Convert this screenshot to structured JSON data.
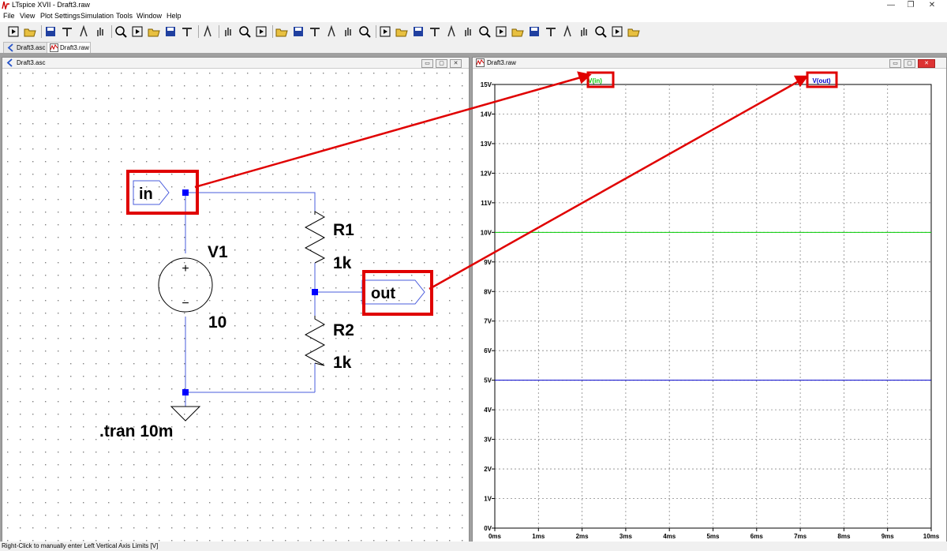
{
  "window": {
    "title": "LTspice XVII - Draft3.raw"
  },
  "menu": [
    "File",
    "View",
    "Plot Settings",
    "Simulation",
    "Tools",
    "Window",
    "Help"
  ],
  "toolbar": {
    "icons": [
      "run-icon",
      "open-icon",
      "save-icon",
      "control-panel-icon",
      "halt-icon",
      "pan-hand-icon",
      "zoom-in-icon",
      "zoom-out-icon",
      "zoom-fit-icon",
      "zoom-cancel-icon",
      "autorange-icon",
      "mark-icon",
      "tile-horizontal-icon",
      "tile-vertical-icon",
      "cascade-icon",
      "cut-icon",
      "copy-icon",
      "paste-icon",
      "find-icon",
      "print-icon",
      "print-preview-icon",
      "wire-icon",
      "ground-icon",
      "label-icon",
      "resistor-icon",
      "capacitor-icon",
      "inductor-icon",
      "diode-icon",
      "component-icon",
      "move-icon",
      "drag-icon",
      "undo-icon",
      "redo-icon",
      "rotate-icon",
      "mirror-icon",
      "text-icon",
      "spice-directive-icon"
    ]
  },
  "tabs": [
    {
      "label": "Draft3.asc",
      "active": false
    },
    {
      "label": "Draft3.raw",
      "active": true
    }
  ],
  "schematic": {
    "title": "Draft3.asc",
    "label_in": "in",
    "label_out": "out",
    "v1_name": "V1",
    "v1_value": "10",
    "r1_name": "R1",
    "r1_value": "1k",
    "r2_name": "R2",
    "r2_value": "1k",
    "directive": ".tran 10m",
    "plus": "+",
    "minus": "−"
  },
  "plot": {
    "title": "Draft3.raw",
    "trace_labels": [
      "V(in)",
      "V(out)"
    ],
    "trace_colors": [
      "#00cc00",
      "#0000cc"
    ],
    "highlight_color": "#e00000"
  },
  "chart_data": {
    "type": "line",
    "title": "",
    "xlabel": "",
    "ylabel": "",
    "x_ticks": [
      "0ms",
      "1ms",
      "2ms",
      "3ms",
      "4ms",
      "5ms",
      "6ms",
      "7ms",
      "8ms",
      "9ms",
      "10ms"
    ],
    "y_ticks": [
      "0V",
      "1V",
      "2V",
      "3V",
      "4V",
      "5V",
      "6V",
      "7V",
      "8V",
      "9V",
      "10V",
      "11V",
      "12V",
      "13V",
      "14V",
      "15V"
    ],
    "xlim": [
      0,
      10
    ],
    "ylim": [
      0,
      15
    ],
    "grid": true,
    "series": [
      {
        "name": "V(in)",
        "x": [
          0,
          10
        ],
        "values": [
          10,
          10
        ]
      },
      {
        "name": "V(out)",
        "x": [
          0,
          10
        ],
        "values": [
          5,
          5
        ]
      }
    ]
  },
  "status": {
    "text": "Right-Click to manually enter Left Vertical Axis Limits [V]"
  }
}
